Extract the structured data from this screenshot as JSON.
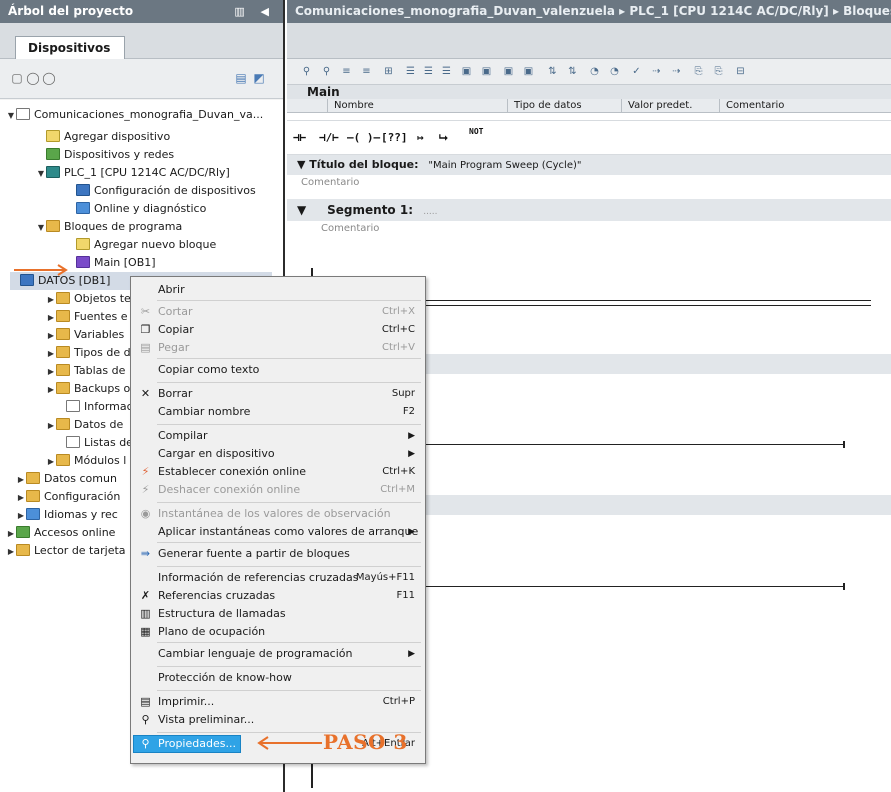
{
  "left_pane": {
    "title": "Árbol del proyecto",
    "devices_tab": "Dispositivos",
    "tree": [
      {
        "label": "Comunicaciones_monografia_Duvan_va...",
        "icon": "page",
        "toggle": "▼"
      },
      {
        "label": "Agregar dispositivo",
        "icon": "add",
        "toggle": ""
      },
      {
        "label": "Dispositivos y redes",
        "icon": "green",
        "toggle": ""
      },
      {
        "label": "PLC_1 [CPU 1214C AC/DC/Rly]",
        "icon": "plc",
        "toggle": "▼"
      },
      {
        "label": "Configuración de dispositivos",
        "icon": "blue",
        "toggle": ""
      },
      {
        "label": "Online y diagnóstico",
        "icon": "diag",
        "toggle": ""
      },
      {
        "label": "Bloques de programa",
        "icon": "folder",
        "toggle": "▼"
      },
      {
        "label": "Agregar nuevo bloque",
        "icon": "add",
        "toggle": ""
      },
      {
        "label": "Main [OB1]",
        "icon": "purple",
        "toggle": ""
      },
      {
        "label": "DATOS [DB1]",
        "icon": "blue",
        "toggle": ""
      },
      {
        "label": "Objetos te",
        "icon": "folder",
        "toggle": "▶"
      },
      {
        "label": "Fuentes e",
        "icon": "folder",
        "toggle": "▶"
      },
      {
        "label": "Variables",
        "icon": "folder",
        "toggle": "▶"
      },
      {
        "label": "Tipos de d",
        "icon": "folder",
        "toggle": "▶"
      },
      {
        "label": "Tablas de",
        "icon": "folder",
        "toggle": "▶"
      },
      {
        "label": "Backups o",
        "icon": "folder",
        "toggle": "▶"
      },
      {
        "label": "Informaci",
        "icon": "page",
        "toggle": ""
      },
      {
        "label": "Datos de",
        "icon": "folder",
        "toggle": "▶"
      },
      {
        "label": "Listas de",
        "icon": "page",
        "toggle": ""
      },
      {
        "label": "Módulos l",
        "icon": "folder",
        "toggle": "▶"
      },
      {
        "label": "Datos comun",
        "icon": "folder",
        "toggle": "▶"
      },
      {
        "label": "Configuración",
        "icon": "folder",
        "toggle": "▶"
      },
      {
        "label": "Idiomas y rec",
        "icon": "diag",
        "toggle": "▶"
      },
      {
        "label": "Accesos online",
        "icon": "green",
        "toggle": "▶"
      },
      {
        "label": "Lector de tarjeta",
        "icon": "folder",
        "toggle": "▶"
      }
    ]
  },
  "right_pane": {
    "breadcrumb": "Comunicaciones_monografia_Duvan_valenzuela ▸ PLC_1 [CPU 1214C AC/DC/Rly] ▸ Bloques de",
    "main_label": "Main",
    "interface_columns": [
      "Nombre",
      "Tipo de datos",
      "Valor predet.",
      "Comentario"
    ],
    "ladder_tools": [
      "⊣⊢",
      "⊣/⊢",
      "–( )–",
      "[??]",
      "↦",
      "⮡",
      "NOT"
    ],
    "block_title_label": "Título del bloque:",
    "block_title_value": "\"Main Program Sweep (Cycle)\"",
    "comment_label": "Comentario",
    "segment_label": "Segmento 1:",
    "segment_suffix": "....."
  },
  "context_menu": {
    "items": [
      {
        "label": "Abrir",
        "shortcut": "",
        "icon": "",
        "disabled": false,
        "submenu": false
      },
      {
        "label": "Cortar",
        "shortcut": "Ctrl+X",
        "icon": "scissors-icon",
        "disabled": true,
        "submenu": false
      },
      {
        "label": "Copiar",
        "shortcut": "Ctrl+C",
        "icon": "copy-icon",
        "disabled": false,
        "submenu": false
      },
      {
        "label": "Pegar",
        "shortcut": "Ctrl+V",
        "icon": "paste-icon",
        "disabled": true,
        "submenu": false
      },
      {
        "label": "Copiar como texto",
        "shortcut": "",
        "icon": "",
        "disabled": false,
        "submenu": false
      },
      {
        "label": "Borrar",
        "shortcut": "Supr",
        "icon": "delete-icon",
        "disabled": false,
        "submenu": false
      },
      {
        "label": "Cambiar nombre",
        "shortcut": "F2",
        "icon": "",
        "disabled": false,
        "submenu": false
      },
      {
        "label": "Compilar",
        "shortcut": "",
        "icon": "",
        "disabled": false,
        "submenu": true
      },
      {
        "label": "Cargar en dispositivo",
        "shortcut": "",
        "icon": "",
        "disabled": false,
        "submenu": true
      },
      {
        "label": "Establecer conexión online",
        "shortcut": "Ctrl+K",
        "icon": "connect-icon",
        "disabled": false,
        "submenu": false
      },
      {
        "label": "Deshacer conexión online",
        "shortcut": "Ctrl+M",
        "icon": "disconnect-icon",
        "disabled": true,
        "submenu": false
      },
      {
        "label": "Instantánea de los valores de observación",
        "shortcut": "",
        "icon": "snapshot-icon",
        "disabled": true,
        "submenu": false
      },
      {
        "label": "Aplicar instantáneas como valores de arranque",
        "shortcut": "",
        "icon": "",
        "disabled": false,
        "submenu": true
      },
      {
        "label": "Generar fuente a partir de bloques",
        "shortcut": "",
        "icon": "generate-source-icon",
        "disabled": false,
        "submenu": false
      },
      {
        "label": "Información de referencias cruzadas",
        "shortcut": "Mayús+F11",
        "icon": "",
        "disabled": false,
        "submenu": false
      },
      {
        "label": "Referencias cruzadas",
        "shortcut": "F11",
        "icon": "cross-reference-icon",
        "disabled": false,
        "submenu": false
      },
      {
        "label": "Estructura de llamadas",
        "shortcut": "",
        "icon": "call-structure-icon",
        "disabled": false,
        "submenu": false
      },
      {
        "label": "Plano de ocupación",
        "shortcut": "",
        "icon": "assignment-icon",
        "disabled": false,
        "submenu": false
      },
      {
        "label": "Cambiar lenguaje de programación",
        "shortcut": "",
        "icon": "",
        "disabled": false,
        "submenu": true
      },
      {
        "label": "Protección de know-how",
        "shortcut": "",
        "icon": "",
        "disabled": false,
        "submenu": false
      },
      {
        "label": "Imprimir...",
        "shortcut": "Ctrl+P",
        "icon": "print-icon",
        "disabled": false,
        "submenu": false
      },
      {
        "label": "Vista preliminar...",
        "shortcut": "",
        "icon": "print-preview-icon",
        "disabled": false,
        "submenu": false
      },
      {
        "label": "Propiedades...",
        "shortcut": "Alt+Entrar",
        "icon": "properties-icon",
        "disabled": false,
        "submenu": false
      }
    ]
  },
  "annotations": {
    "step_label": "PASO 3",
    "color": "#e8712b"
  }
}
